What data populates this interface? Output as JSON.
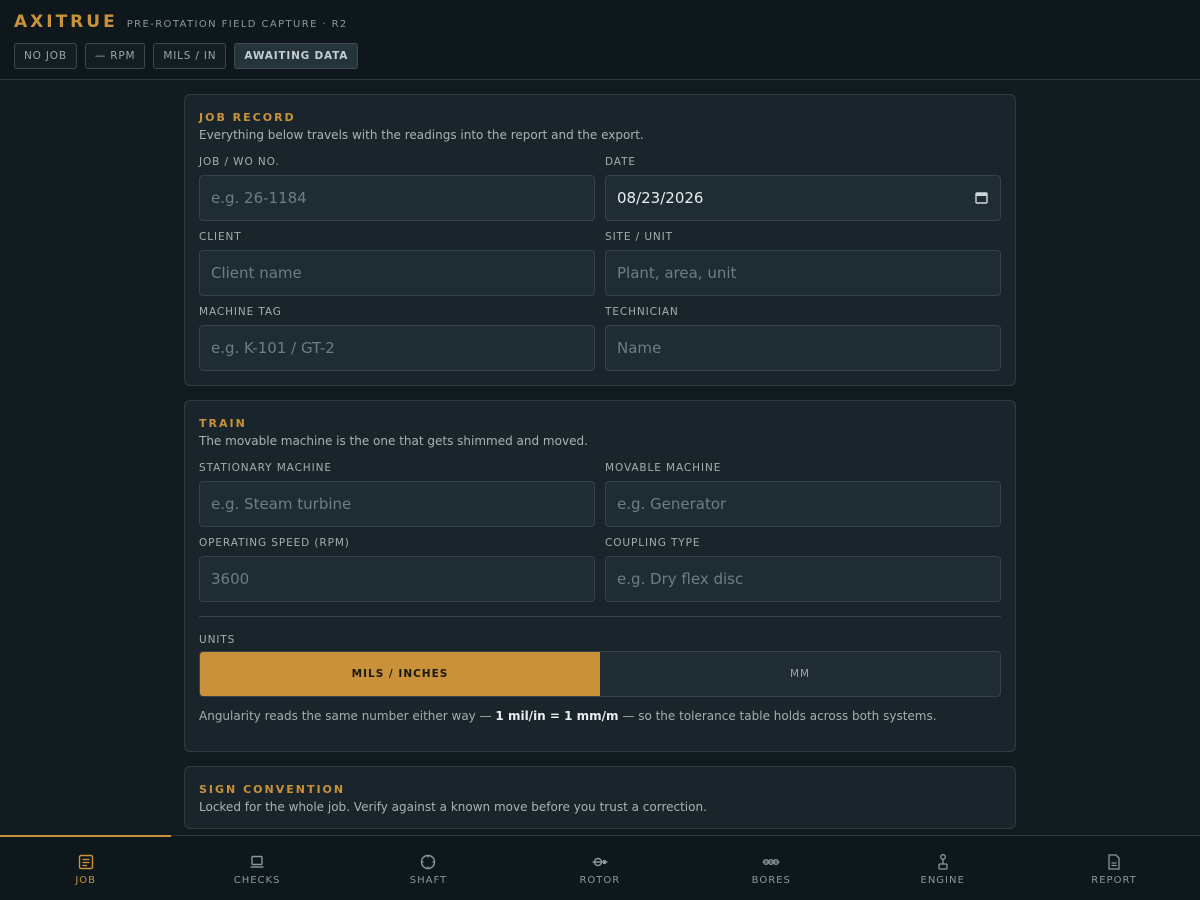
{
  "header": {
    "brand": "AXITRUE",
    "subtitle": "PRE-ROTATION FIELD CAPTURE · R2",
    "chips": [
      "NO JOB",
      "— RPM",
      "MILS / IN"
    ],
    "status": "AWAITING DATA"
  },
  "job_record": {
    "title": "JOB RECORD",
    "desc": "Everything below travels with the readings into the report and the export.",
    "job_label": "JOB / WO NO.",
    "job_placeholder": "e.g. 26-1184",
    "date_label": "DATE",
    "date_value": "08/23/2026",
    "client_label": "CLIENT",
    "client_placeholder": "Client name",
    "site_label": "SITE / UNIT",
    "site_placeholder": "Plant, area, unit",
    "tag_label": "MACHINE TAG",
    "tag_placeholder": "e.g. K-101 / GT-2",
    "tech_label": "TECHNICIAN",
    "tech_placeholder": "Name"
  },
  "train": {
    "title": "TRAIN",
    "desc": "The movable machine is the one that gets shimmed and moved.",
    "stationary_label": "STATIONARY MACHINE",
    "stationary_placeholder": "e.g. Steam turbine",
    "movable_label": "MOVABLE MACHINE",
    "movable_placeholder": "e.g. Generator",
    "speed_label": "OPERATING SPEED (RPM)",
    "speed_placeholder": "3600",
    "coupling_label": "COUPLING TYPE",
    "coupling_placeholder": "e.g. Dry flex disc",
    "units_label": "UNITS",
    "units_options": [
      "MILS / INCHES",
      "MM"
    ],
    "units_selected": "MILS / INCHES",
    "note_pre": "Angularity reads the same number either way — ",
    "note_bold": "1 mil/in = 1 mm/m",
    "note_post": " — so the tolerance table holds across both systems."
  },
  "sign_convention": {
    "title": "SIGN CONVENTION",
    "desc": "Locked for the whole job. Verify against a known move before you trust a correction."
  },
  "nav": {
    "items": [
      "JOB",
      "CHECKS",
      "SHAFT",
      "ROTOR",
      "BORES",
      "ENGINE",
      "REPORT"
    ],
    "active": "JOB"
  },
  "colors": {
    "accent": "#c9913a",
    "background": "#101b20",
    "card": "#1a252b"
  }
}
